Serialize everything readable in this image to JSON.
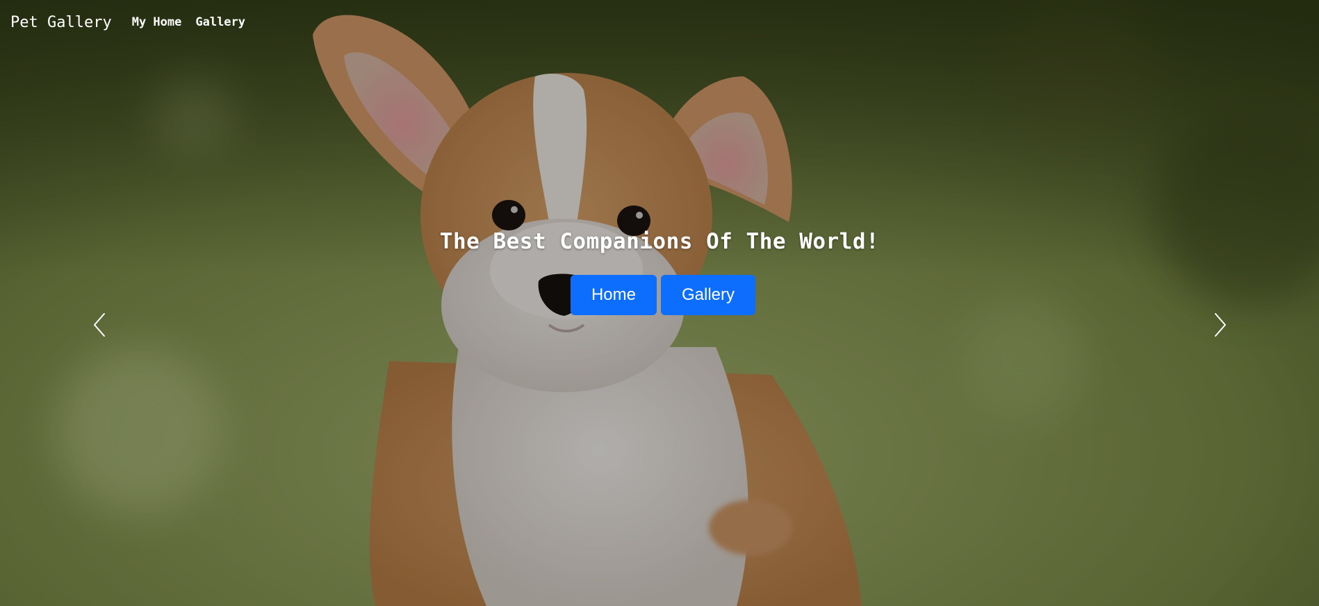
{
  "nav": {
    "brand": "Pet Gallery",
    "links": [
      "My Home",
      "Gallery"
    ]
  },
  "hero": {
    "headline": "The Best Companions Of The World!",
    "buttons": [
      "Home",
      "Gallery"
    ],
    "image": "corgi-puppy-photo"
  },
  "carousel": {
    "prev_icon": "chevron-left-icon",
    "next_icon": "chevron-right-icon"
  },
  "colors": {
    "button": "#0d6efd",
    "text": "#ffffff"
  }
}
